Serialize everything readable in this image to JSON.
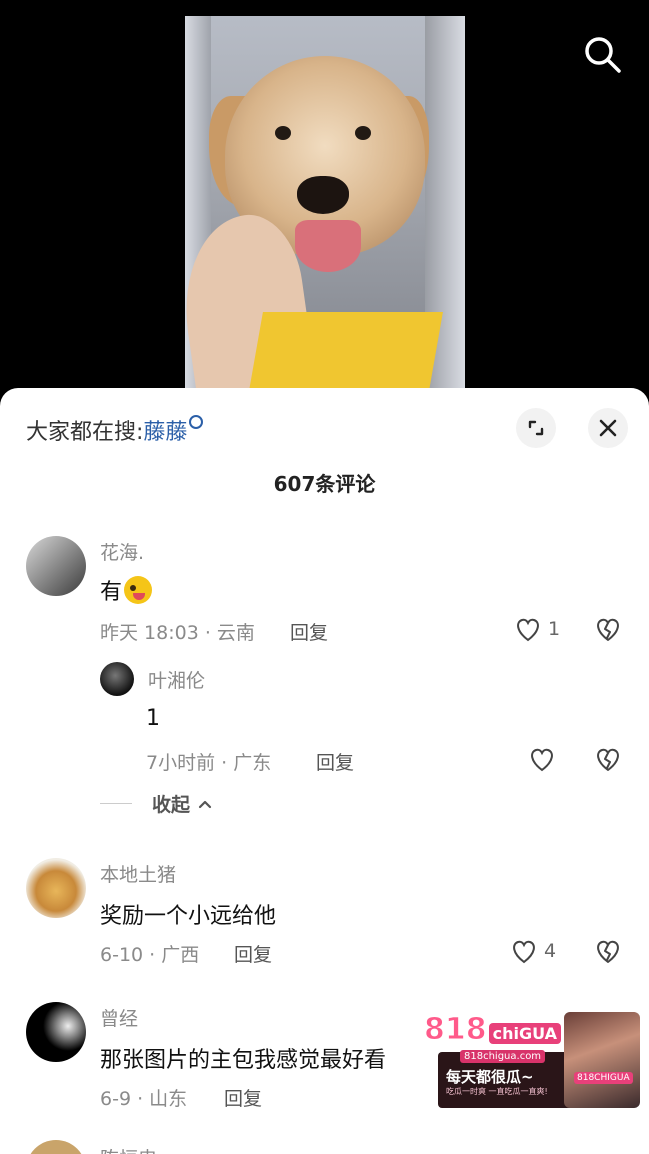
{
  "search_suggestion": {
    "prefix": "大家都在搜:",
    "term": "藤藤"
  },
  "comment_count": "607条评论",
  "comments": [
    {
      "name": "花海.",
      "text": "有",
      "time": "昨天 18:03 · 云南",
      "reply": "回复",
      "likes": "1"
    },
    {
      "name": "叶湘伦",
      "text": "1",
      "time": "7小时前 · 广东",
      "reply": "回复",
      "likes": ""
    },
    {
      "name": "本地土猪",
      "text": "奖励一个小远给他",
      "time": "6-10 · 广西",
      "reply": "回复",
      "likes": "4"
    },
    {
      "name": "曾经",
      "text": "那张图片的主包我感觉最好看",
      "time": "6-9 · 山东",
      "reply": "回复",
      "likes": ""
    },
    {
      "name": "陈恒忠"
    }
  ],
  "collapse_label": "收起",
  "ad": {
    "logo": "818",
    "logo_suffix": "chiGUA",
    "url": "818chigua.com",
    "slogan": "每天都很瓜~",
    "sub": "吃瓜一时爽 一直吃瓜一直爽!",
    "badge": "818CHIGUA"
  },
  "icons": [
    "search-icon",
    "expand-icon",
    "close-icon",
    "heart-icon",
    "broken-heart-icon",
    "chevron-up-icon"
  ]
}
